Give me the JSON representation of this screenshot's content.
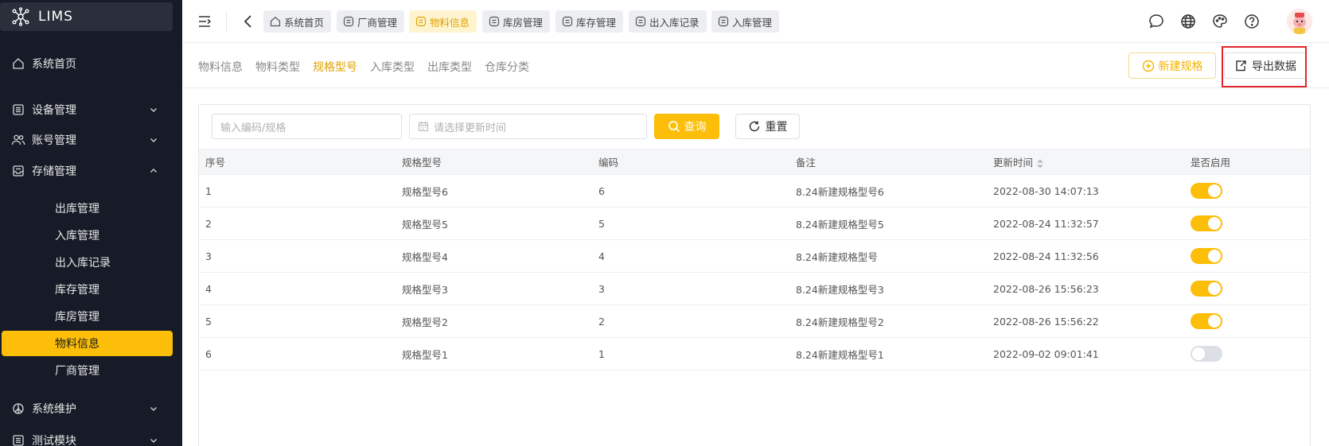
{
  "app": {
    "title": "LIMS"
  },
  "sidebar": {
    "items": [
      {
        "label": "系统首页",
        "icon": "home-icon"
      },
      {
        "label": "设备管理",
        "icon": "device-icon",
        "expanded": false
      },
      {
        "label": "账号管理",
        "icon": "users-icon",
        "expanded": false
      },
      {
        "label": "存储管理",
        "icon": "storage-icon",
        "expanded": true
      },
      {
        "label": "系统维护",
        "icon": "maintenance-icon",
        "expanded": false
      },
      {
        "label": "测试模块",
        "icon": "test-icon",
        "expanded": false
      }
    ],
    "sub_items": [
      "出库管理",
      "入库管理",
      "出入库记录",
      "库存管理",
      "库房管理",
      "物料信息",
      "厂商管理"
    ],
    "active_sub": "物料信息"
  },
  "tabs": [
    {
      "label": "系统首页",
      "icon": "home-icon"
    },
    {
      "label": "厂商管理",
      "icon": "tab-icon"
    },
    {
      "label": "物料信息",
      "icon": "tab-icon",
      "active": true
    },
    {
      "label": "库房管理",
      "icon": "tab-icon"
    },
    {
      "label": "库存管理",
      "icon": "tab-icon"
    },
    {
      "label": "出入库记录",
      "icon": "tab-icon"
    },
    {
      "label": "入库管理",
      "icon": "tab-icon"
    }
  ],
  "subnav": {
    "items": [
      "物料信息",
      "物料类型",
      "规格型号",
      "入库类型",
      "出库类型",
      "仓库分类"
    ],
    "active": "规格型号"
  },
  "actions": {
    "new_label": "新建规格",
    "export_label": "导出数据"
  },
  "filters": {
    "code_placeholder": "输入编码/规格",
    "date_placeholder": "请选择更新时间",
    "query_label": "查询",
    "reset_label": "重置"
  },
  "table": {
    "headers": [
      "序号",
      "规格型号",
      "编码",
      "备注",
      "更新时间",
      "是否启用"
    ],
    "rows": [
      {
        "index": "1",
        "spec": "规格型号6",
        "code": "6",
        "note": "8.24新建规格型号6",
        "updated": "2022-08-30 14:07:13",
        "enabled": true
      },
      {
        "index": "2",
        "spec": "规格型号5",
        "code": "5",
        "note": "8.24新建规格型号5",
        "updated": "2022-08-24 11:32:57",
        "enabled": true
      },
      {
        "index": "3",
        "spec": "规格型号4",
        "code": "4",
        "note": "8.24新建规格型号",
        "updated": "2022-08-24 11:32:56",
        "enabled": true
      },
      {
        "index": "4",
        "spec": "规格型号3",
        "code": "3",
        "note": "8.24新建规格型号3",
        "updated": "2022-08-26 15:56:23",
        "enabled": true
      },
      {
        "index": "5",
        "spec": "规格型号2",
        "code": "2",
        "note": "8.24新建规格型号2",
        "updated": "2022-08-26 15:56:22",
        "enabled": true
      },
      {
        "index": "6",
        "spec": "规格型号1",
        "code": "1",
        "note": "8.24新建规格型号1",
        "updated": "2022-09-02 09:01:41",
        "enabled": false
      }
    ]
  },
  "colors": {
    "accent": "#fcbe08",
    "sidebar_bg": "#161b27",
    "highlight": "#e0262b"
  }
}
